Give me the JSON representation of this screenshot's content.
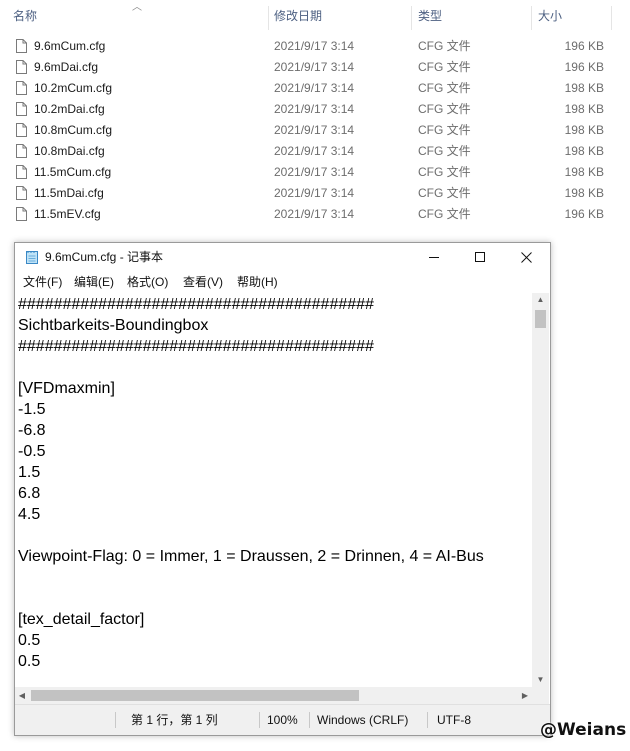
{
  "explorer": {
    "columns": {
      "name": "名称",
      "date": "修改日期",
      "type": "类型",
      "size": "大小"
    },
    "files": [
      {
        "name": "9.6mCum.cfg",
        "date": "2021/9/17 3:14",
        "type": "CFG 文件",
        "size": "196 KB"
      },
      {
        "name": "9.6mDai.cfg",
        "date": "2021/9/17 3:14",
        "type": "CFG 文件",
        "size": "196 KB"
      },
      {
        "name": "10.2mCum.cfg",
        "date": "2021/9/17 3:14",
        "type": "CFG 文件",
        "size": "198 KB"
      },
      {
        "name": "10.2mDai.cfg",
        "date": "2021/9/17 3:14",
        "type": "CFG 文件",
        "size": "198 KB"
      },
      {
        "name": "10.8mCum.cfg",
        "date": "2021/9/17 3:14",
        "type": "CFG 文件",
        "size": "198 KB"
      },
      {
        "name": "10.8mDai.cfg",
        "date": "2021/9/17 3:14",
        "type": "CFG 文件",
        "size": "198 KB"
      },
      {
        "name": "11.5mCum.cfg",
        "date": "2021/9/17 3:14",
        "type": "CFG 文件",
        "size": "198 KB"
      },
      {
        "name": "11.5mDai.cfg",
        "date": "2021/9/17 3:14",
        "type": "CFG 文件",
        "size": "198 KB"
      },
      {
        "name": "11.5mEV.cfg",
        "date": "2021/9/17 3:14",
        "type": "CFG 文件",
        "size": "196 KB"
      }
    ]
  },
  "notepad": {
    "title": "9.6mCum.cfg - 记事本",
    "menu": {
      "file": "文件(F)",
      "edit": "编辑(E)",
      "format": "格式(O)",
      "view": "查看(V)",
      "help": "帮助(H)"
    },
    "content": "########################################\nSichtbarkeits-Boundingbox\n########################################\n\n[VFDmaxmin]\n-1.5\n-6.8\n-0.5\n1.5\n6.8\n4.5\n\nViewpoint-Flag: 0 = Immer, 1 = Draussen, 2 = Drinnen, 4 = AI-Bus\n\n\n[tex_detail_factor]\n0.5\n0.5",
    "status": {
      "position": "第 1 行，第 1 列",
      "zoom": "100%",
      "line_ending": "Windows (CRLF)",
      "encoding": "UTF-8"
    }
  },
  "watermark": "@Weians",
  "colors": {
    "header_text": "#4d6082",
    "secondary_text": "#6d6d6d",
    "statusbar_bg": "#f0f0f0"
  }
}
